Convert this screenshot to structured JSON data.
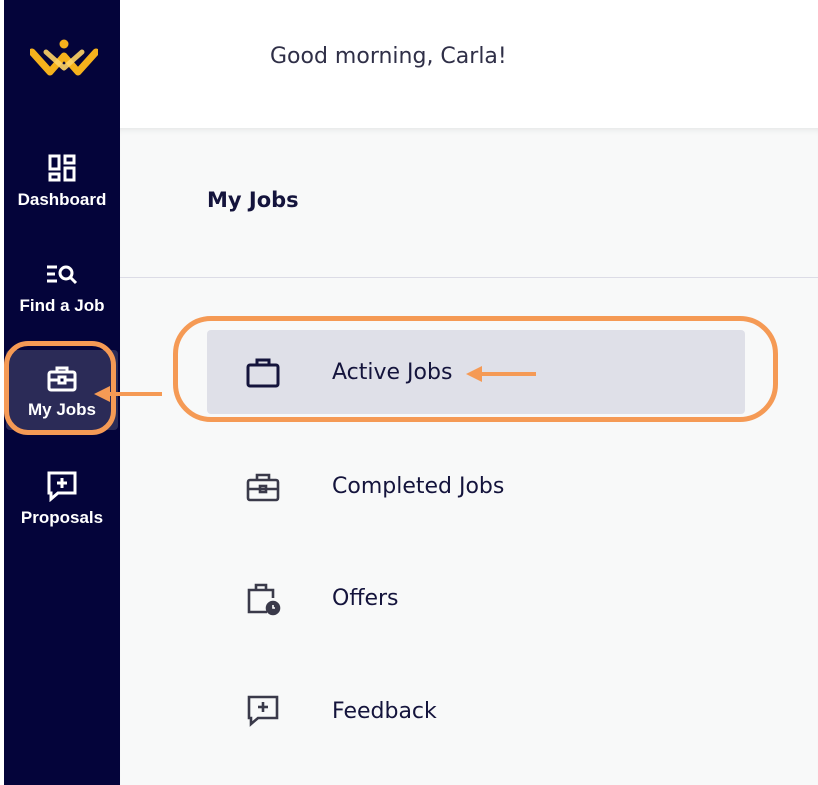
{
  "header": {
    "greeting": "Good morning, Carla!"
  },
  "sidebar": {
    "logo": "brand-logo",
    "items": [
      {
        "label": "Dashboard",
        "icon": "dashboard-icon"
      },
      {
        "label": "Find a Job",
        "icon": "job-search-icon"
      },
      {
        "label": "My Jobs",
        "icon": "briefcase-icon",
        "active": true
      },
      {
        "label": "Proposals",
        "icon": "proposal-icon"
      }
    ]
  },
  "main": {
    "title": "My Jobs",
    "menu": [
      {
        "label": "Active Jobs",
        "icon": "briefcase-outline-icon",
        "active": true
      },
      {
        "label": "Completed Jobs",
        "icon": "briefcase-check-icon"
      },
      {
        "label": "Offers",
        "icon": "clipboard-clock-icon"
      },
      {
        "label": "Feedback",
        "icon": "feedback-icon"
      }
    ]
  },
  "colors": {
    "sidebar_bg": "#04043a",
    "active_item_bg": "#dfe0e8",
    "annotation": "#f59a55",
    "logo_gold": "#f5b21c"
  }
}
